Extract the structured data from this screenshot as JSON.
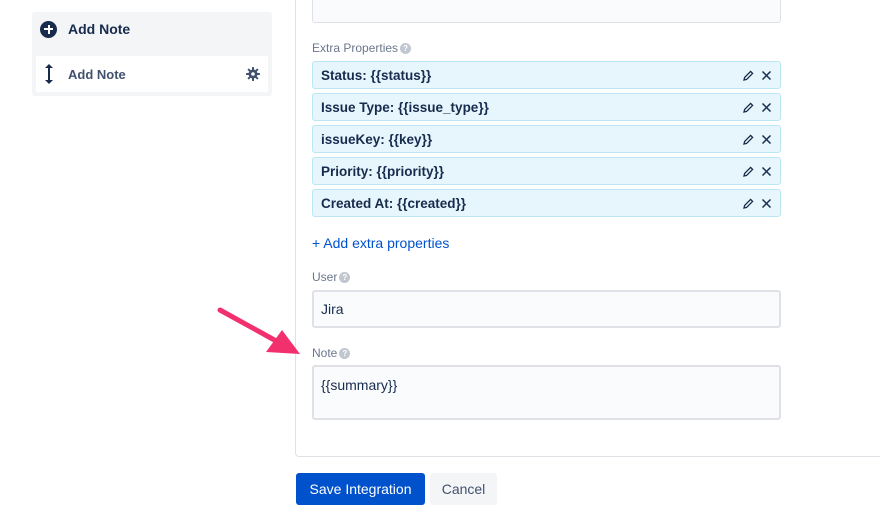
{
  "sidebar": {
    "header_label": "Add Note",
    "item_label": "Add Note"
  },
  "form": {
    "extra_properties_label": "Extra Properties",
    "properties": [
      {
        "label": "Status: {{status}}"
      },
      {
        "label": "Issue Type: {{issue_type}}"
      },
      {
        "label": "issueKey: {{key}}"
      },
      {
        "label": "Priority: {{priority}}"
      },
      {
        "label": "Created At: {{created}}"
      }
    ],
    "add_properties_link": "+ Add extra properties",
    "user_label": "User",
    "user_value": "Jira",
    "note_label": "Note",
    "note_value": "{{summary}}"
  },
  "buttons": {
    "save": "Save Integration",
    "cancel": "Cancel"
  },
  "colors": {
    "primary": "#0052cc",
    "property_bg": "#e6f6fc",
    "annotation_arrow": "#f2306e"
  }
}
